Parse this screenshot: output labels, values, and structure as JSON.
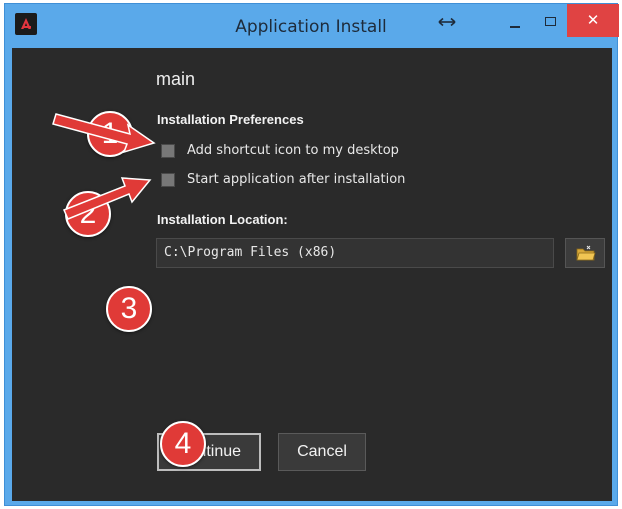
{
  "window": {
    "title": "Application Install",
    "controls": {
      "resize_glyph": "↔",
      "close_glyph": "✕"
    }
  },
  "content": {
    "heading": "main",
    "preferences": {
      "label": "Installation Preferences",
      "options": [
        {
          "label": "Add shortcut icon to my desktop",
          "checked": false
        },
        {
          "label": "Start application after installation",
          "checked": false
        }
      ]
    },
    "location": {
      "label": "Installation Location:",
      "value": "C:\\Program Files (x86)"
    },
    "buttons": {
      "continue": "Continue",
      "cancel": "Cancel"
    }
  },
  "annotations": {
    "markers": [
      "1",
      "2",
      "3",
      "4"
    ],
    "color": "#e03a37"
  },
  "icons": {
    "app": "app-logo-icon",
    "browse": "folder-icon"
  }
}
